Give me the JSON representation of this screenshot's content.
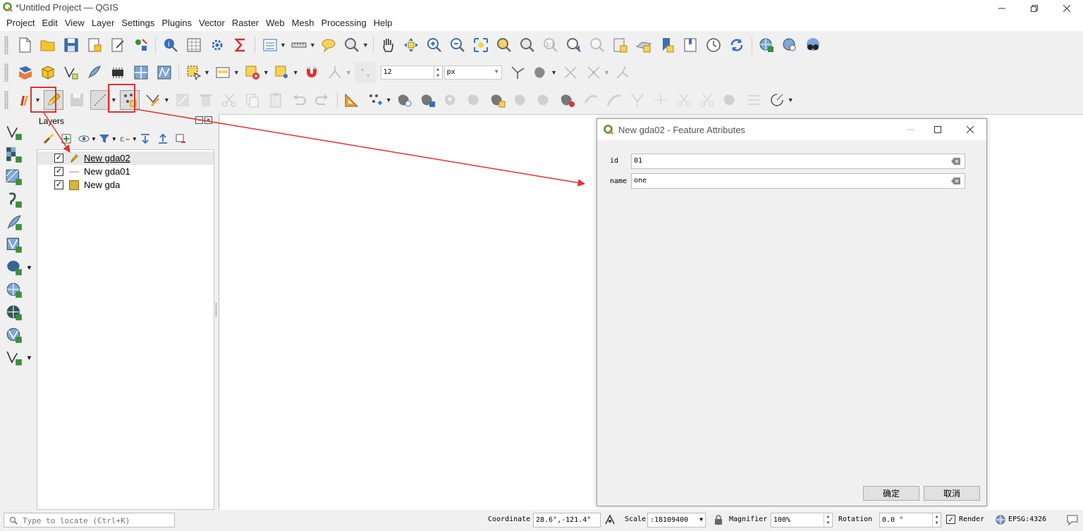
{
  "window": {
    "title": "*Untitled Project — QGIS"
  },
  "menu": [
    "Project",
    "Edit",
    "View",
    "Layer",
    "Settings",
    "Plugins",
    "Vector",
    "Raster",
    "Web",
    "Mesh",
    "Processing",
    "Help"
  ],
  "toolbar2": {
    "size_value": "12",
    "unit_value": "px"
  },
  "layers": {
    "title": "Layers",
    "items": [
      {
        "name": "New gda02",
        "checked": true,
        "selected": true
      },
      {
        "name": "New gda01",
        "checked": true,
        "selected": false
      },
      {
        "name": "New gda",
        "checked": true,
        "selected": false
      }
    ]
  },
  "dialog": {
    "title": "New gda02 - Feature Attributes",
    "fields": [
      {
        "label": "id",
        "value": "01"
      },
      {
        "label": "name",
        "value": "one"
      }
    ],
    "ok_label": "确定",
    "cancel_label": "取消"
  },
  "status": {
    "locate_placeholder": "Type to locate (Ctrl+K)",
    "coordinate_label": "Coordinate",
    "coordinate_value": "28.6°,-121.4°",
    "scale_label": "Scale",
    "scale_value": ":18109400",
    "magnifier_label": "Magnifier",
    "magnifier_value": "100%",
    "rotation_label": "Rotation",
    "rotation_value": "0.0 °",
    "render_label": "Render",
    "crs_label": "EPSG:4326"
  },
  "colors": {
    "highlight": "#e53030",
    "accent_green": "#3c8e3c"
  }
}
